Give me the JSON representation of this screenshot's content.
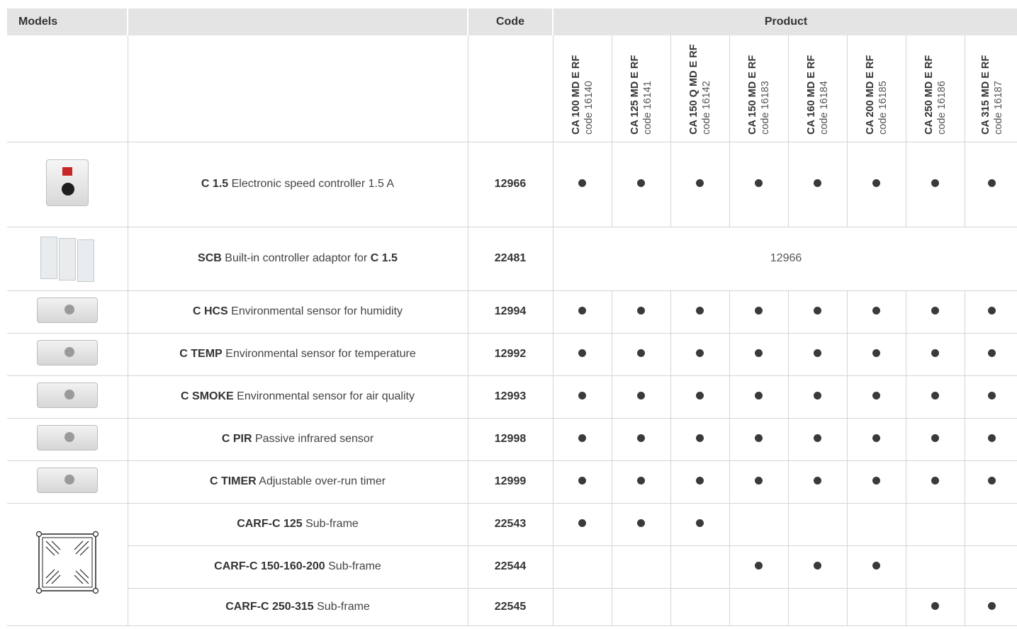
{
  "headers": {
    "models": "Models",
    "code": "Code",
    "product": "Product"
  },
  "products": [
    {
      "model": "CA 100 MD E RF",
      "code": "code 16140"
    },
    {
      "model": "CA 125 MD E RF",
      "code": "code 16141"
    },
    {
      "model": "CA 150 Q MD E RF",
      "code": "code 16142"
    },
    {
      "model": "CA 150 MD E RF",
      "code": "code 16183"
    },
    {
      "model": "CA 160 MD E RF",
      "code": "code 16184"
    },
    {
      "model": "CA 200 MD E RF",
      "code": "code 16185"
    },
    {
      "model": "CA 250 MD E RF",
      "code": "code 16186"
    },
    {
      "model": "CA 315 MD E RF",
      "code": "code 16187"
    }
  ],
  "rows": [
    {
      "name": "C 1.5",
      "desc": " Electronic speed controller 1.5 A",
      "code": "12966",
      "compat": [
        true,
        true,
        true,
        true,
        true,
        true,
        true,
        true
      ]
    },
    {
      "name": "SCB",
      "desc": " Built-in controller adaptor for ",
      "name2": "C 1.5",
      "code": "22481",
      "note": "12966"
    },
    {
      "name": "C HCS",
      "desc": " Environmental sensor for humidity",
      "code": "12994",
      "compat": [
        true,
        true,
        true,
        true,
        true,
        true,
        true,
        true
      ]
    },
    {
      "name": "C TEMP",
      "desc": " Environmental sensor for temperature",
      "code": "12992",
      "compat": [
        true,
        true,
        true,
        true,
        true,
        true,
        true,
        true
      ]
    },
    {
      "name": "C SMOKE",
      "desc": " Environmental sensor for air quality",
      "code": "12993",
      "compat": [
        true,
        true,
        true,
        true,
        true,
        true,
        true,
        true
      ]
    },
    {
      "name": "C PIR",
      "desc": " Passive infrared sensor",
      "code": "12998",
      "compat": [
        true,
        true,
        true,
        true,
        true,
        true,
        true,
        true
      ]
    },
    {
      "name": "C TIMER",
      "desc": " Adjustable over-run timer",
      "code": "12999",
      "compat": [
        true,
        true,
        true,
        true,
        true,
        true,
        true,
        true
      ]
    },
    {
      "name": "CARF-C 125",
      "desc": " Sub-frame",
      "code": "22543",
      "compat": [
        true,
        true,
        true,
        false,
        false,
        false,
        false,
        false
      ]
    },
    {
      "name": "CARF-C 150-160-200",
      "desc": " Sub-frame",
      "code": "22544",
      "compat": [
        false,
        false,
        false,
        true,
        true,
        true,
        false,
        false
      ]
    },
    {
      "name": "CARF-C 250-315",
      "desc": " Sub-frame",
      "code": "22545",
      "compat": [
        false,
        false,
        false,
        false,
        false,
        false,
        true,
        true
      ]
    }
  ]
}
